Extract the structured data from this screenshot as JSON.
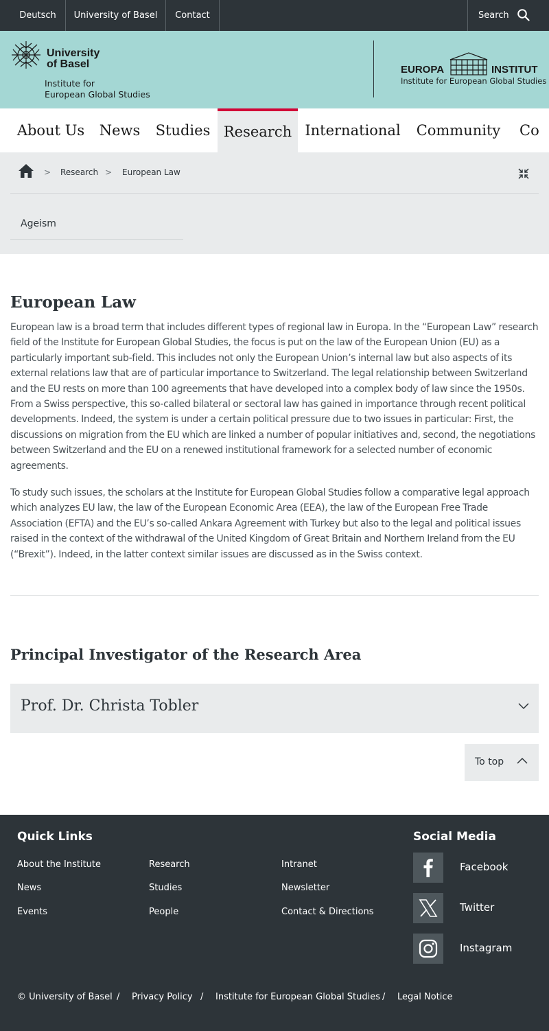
{
  "topbar": {
    "links": [
      "Deutsch",
      "University of Basel",
      "Contact"
    ],
    "search_label": "Search",
    "search_icon": "search-icon"
  },
  "header": {
    "university_line1": "University",
    "university_line2": "of Basel",
    "institute_line1": "Institute for",
    "institute_line2": "European Global Studies",
    "europa_word1": "EUROPA",
    "europa_word2": "INSTITUT",
    "europa_sub": "Institute for European Global Studies"
  },
  "nav": {
    "items": [
      "About Us",
      "News",
      "Studies",
      "Research",
      "International",
      "Community",
      "Co"
    ],
    "active": "Research"
  },
  "breadcrumb": {
    "home_icon": "home-icon",
    "items": [
      "Research",
      "European Law"
    ],
    "separator": ">",
    "collapse_icon": "collapse-icon"
  },
  "subnav": {
    "items": [
      "Ageism"
    ]
  },
  "content": {
    "title": "European Law",
    "paragraph1": "European law is a broad term that includes different types of regional law in Europa. In the “European Law” research field of the Institute for European Global Studies, the focus is put on the law of the European Union (EU) as a particularly important sub-field. This includes not only the European Union’s internal law but also aspects of its external relations law that are of particular importance to Switzerland. The legal relationship between Switzerland and the EU rests on more than 100 agreements that have developed into a complex body of law since the 1950s. From a Swiss perspective, this so-called bilateral or sectoral law has gained in importance through recent political developments. Indeed, the system is under a certain political pressure due to two issues in particular: First, the discussions on migration from the EU which are linked a number of popular initiatives and, second, the negotiations between Switzerland and the EU on a renewed institutional framework for a selected number of economic agreements.",
    "paragraph2": "To study such issues, the scholars at the Institute for European Global Studies follow a comparative legal approach which analyzes EU law, the law of the European Economic Area (EEA), the law of the European Free Trade Association (EFTA) and the EU’s so-called Ankara Agreement with Turkey but also to the legal and political issues raised in the context of the withdrawal of the United Kingdom of Great Britain and Northern Ireland from the EU (“Brexit”). Indeed, in the latter context similar issues are discussed as in the Swiss context."
  },
  "investigator": {
    "section_title": "Principal Investigator of the Research Area",
    "name": "Prof. Dr. Christa Tobler"
  },
  "to_top_label": "To top",
  "footer": {
    "quick_links_title": "Quick Links",
    "quick_links": [
      [
        "About the Institute",
        "Research",
        "Intranet"
      ],
      [
        "News",
        "Studies",
        "Newsletter"
      ],
      [
        "Events",
        "People",
        "Contact & Directions"
      ]
    ],
    "social_title": "Social Media",
    "social": [
      {
        "label": "Facebook",
        "icon": "facebook-icon"
      },
      {
        "label": "Twitter",
        "icon": "x-twitter-icon"
      },
      {
        "label": "Instagram",
        "icon": "instagram-icon"
      }
    ],
    "legal": [
      "© University of Basel",
      "Privacy Policy",
      "Institute for European Global Studies",
      "Legal Notice"
    ],
    "legal_separator": "/"
  },
  "colors": {
    "header_bg": "#a4d7d4",
    "dark": "#2d3439",
    "accent": "#d20537",
    "light_grey": "#e9ebec"
  }
}
